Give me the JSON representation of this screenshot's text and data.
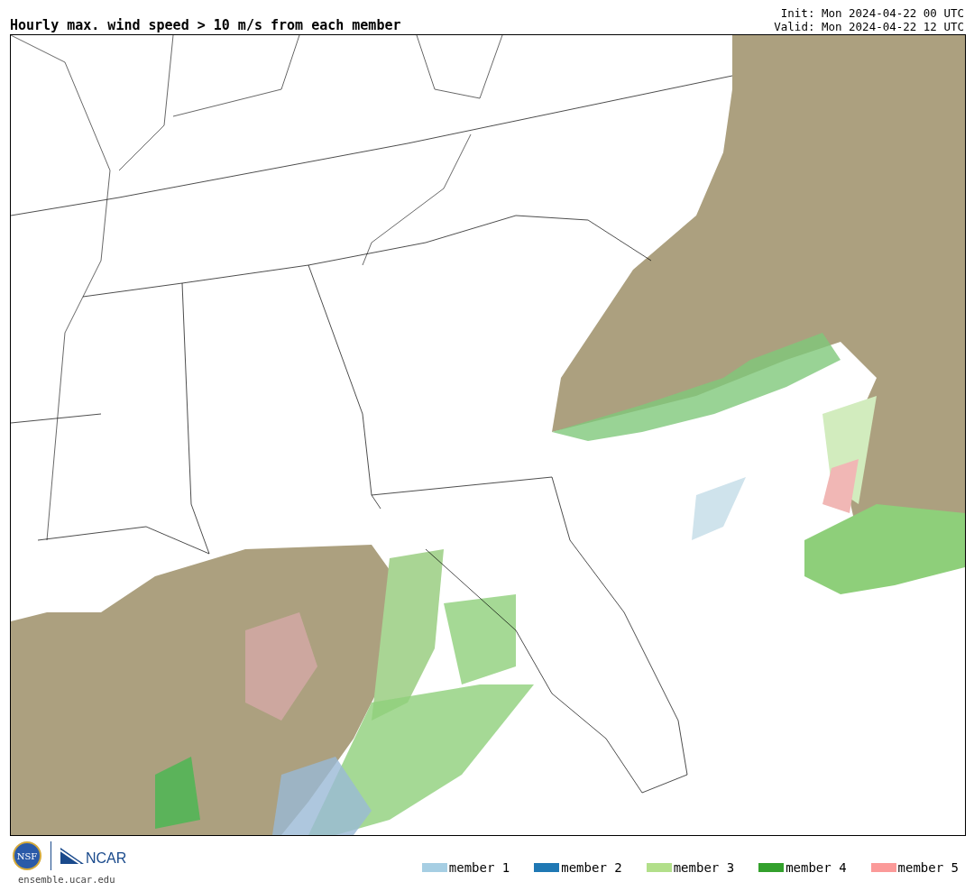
{
  "title": "Hourly max. wind speed > 10 m/s from each member",
  "init": "Init: Mon 2024-04-22 00 UTC",
  "valid": "Valid: Mon 2024-04-22 12 UTC",
  "logos": {
    "nsf": "NSF",
    "ncar": "NCAR"
  },
  "site": "ensemble.ucar.edu",
  "legend": [
    {
      "label": "member 1",
      "color": "#a6cee3"
    },
    {
      "label": "member 2",
      "color": "#1f78b4"
    },
    {
      "label": "member 3",
      "color": "#b2df8a"
    },
    {
      "label": "member 4",
      "color": "#33a02c"
    },
    {
      "label": "member 5",
      "color": "#fb9a99"
    }
  ]
}
